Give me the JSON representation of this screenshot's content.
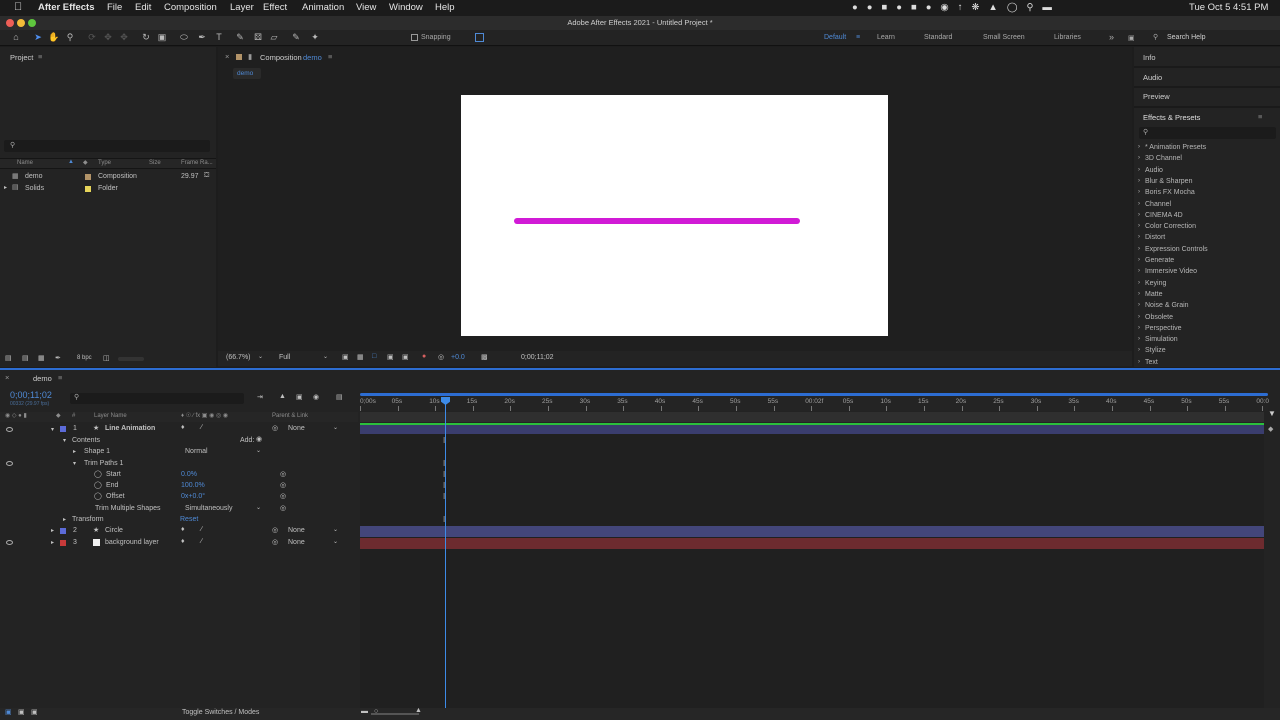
{
  "menubar": {
    "app_name": "After Effects",
    "items": [
      "File",
      "Edit",
      "Composition",
      "Layer",
      "Effect",
      "Animation",
      "View",
      "Window",
      "Help"
    ],
    "clock": "Tue Oct 5  4:51 PM"
  },
  "titlebar": {
    "title": "Adobe After Effects 2021 - Untitled Project *"
  },
  "toolbar": {
    "snapping_label": "Snapping",
    "workspaces": [
      "Default",
      "Learn",
      "Standard",
      "Small Screen",
      "Libraries"
    ],
    "active_workspace": "Default",
    "search_placeholder": "Search Help"
  },
  "project": {
    "title": "Project",
    "columns": [
      "Name",
      "Type",
      "Size",
      "Frame Ra..."
    ],
    "items": [
      {
        "name": "demo",
        "type": "Composition",
        "size": "",
        "frame_rate": "29.97",
        "label_color": "#b29368"
      },
      {
        "name": "Solids",
        "type": "Folder",
        "size": "",
        "frame_rate": "",
        "label_color": "#e6d45a"
      }
    ],
    "bpc": "8 bpc"
  },
  "composition": {
    "tab_label": "Composition",
    "tab_name": "demo",
    "breadcrumb": "demo",
    "zoom": "(66.7%)",
    "resolution": "Full",
    "exposure": "+0.0",
    "timecode": "0;00;11;02",
    "stroke_color": "#d11ad6"
  },
  "right_panels": {
    "info": "Info",
    "audio": "Audio",
    "preview": "Preview",
    "effects_title": "Effects & Presets",
    "effects": [
      "* Animation Presets",
      "3D Channel",
      "Audio",
      "Blur & Sharpen",
      "Boris FX Mocha",
      "Channel",
      "CINEMA 4D",
      "Color Correction",
      "Distort",
      "Expression Controls",
      "Generate",
      "Immersive Video",
      "Keying",
      "Matte",
      "Noise & Grain",
      "Obsolete",
      "Perspective",
      "Simulation",
      "Stylize",
      "Text"
    ]
  },
  "timeline": {
    "tab_name": "demo",
    "timecode": "0;00;11;02",
    "frames": "00332 (29.97 fps)",
    "col_layer_name": "Layer Name",
    "col_parent": "Parent & Link",
    "ruler": [
      "0;00s",
      "05s",
      "10s",
      "15s",
      "20s",
      "25s",
      "30s",
      "35s",
      "40s",
      "45s",
      "50s",
      "55s",
      "00:02f",
      "05s",
      "10s",
      "15s",
      "20s",
      "25s",
      "30s",
      "35s",
      "40s",
      "45s",
      "50s",
      "55s",
      "00:0"
    ],
    "layers": [
      {
        "num": "1",
        "name": "Line Animation",
        "parent": "None",
        "color": "#5c6bd8"
      },
      {
        "num": "2",
        "name": "Circle",
        "parent": "None",
        "color": "#5c6bd8"
      },
      {
        "num": "3",
        "name": "background layer",
        "parent": "None",
        "color": "#c73a3a"
      }
    ],
    "props": {
      "contents": "Contents",
      "add": "Add:",
      "shape": "Shape 1",
      "blend": "Normal",
      "trim": "Trim Paths 1",
      "start_label": "Start",
      "start_value": "0.0%",
      "end_label": "End",
      "end_value": "100.0%",
      "offset_label": "Offset",
      "offset_value": "0x+0.0°",
      "multiple_label": "Trim Multiple Shapes",
      "multiple_value": "Simultaneously",
      "transform": "Transform",
      "reset": "Reset"
    },
    "footer": "Toggle Switches / Modes"
  }
}
